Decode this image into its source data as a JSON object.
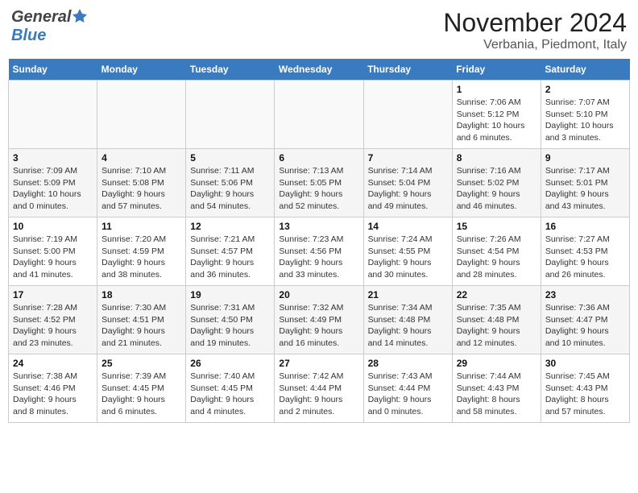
{
  "header": {
    "logo_general": "General",
    "logo_blue": "Blue",
    "month": "November 2024",
    "location": "Verbania, Piedmont, Italy"
  },
  "calendar": {
    "days_of_week": [
      "Sunday",
      "Monday",
      "Tuesday",
      "Wednesday",
      "Thursday",
      "Friday",
      "Saturday"
    ],
    "weeks": [
      [
        {
          "day": "",
          "info": ""
        },
        {
          "day": "",
          "info": ""
        },
        {
          "day": "",
          "info": ""
        },
        {
          "day": "",
          "info": ""
        },
        {
          "day": "",
          "info": ""
        },
        {
          "day": "1",
          "info": "Sunrise: 7:06 AM\nSunset: 5:12 PM\nDaylight: 10 hours\nand 6 minutes."
        },
        {
          "day": "2",
          "info": "Sunrise: 7:07 AM\nSunset: 5:10 PM\nDaylight: 10 hours\nand 3 minutes."
        }
      ],
      [
        {
          "day": "3",
          "info": "Sunrise: 7:09 AM\nSunset: 5:09 PM\nDaylight: 10 hours\nand 0 minutes."
        },
        {
          "day": "4",
          "info": "Sunrise: 7:10 AM\nSunset: 5:08 PM\nDaylight: 9 hours\nand 57 minutes."
        },
        {
          "day": "5",
          "info": "Sunrise: 7:11 AM\nSunset: 5:06 PM\nDaylight: 9 hours\nand 54 minutes."
        },
        {
          "day": "6",
          "info": "Sunrise: 7:13 AM\nSunset: 5:05 PM\nDaylight: 9 hours\nand 52 minutes."
        },
        {
          "day": "7",
          "info": "Sunrise: 7:14 AM\nSunset: 5:04 PM\nDaylight: 9 hours\nand 49 minutes."
        },
        {
          "day": "8",
          "info": "Sunrise: 7:16 AM\nSunset: 5:02 PM\nDaylight: 9 hours\nand 46 minutes."
        },
        {
          "day": "9",
          "info": "Sunrise: 7:17 AM\nSunset: 5:01 PM\nDaylight: 9 hours\nand 43 minutes."
        }
      ],
      [
        {
          "day": "10",
          "info": "Sunrise: 7:19 AM\nSunset: 5:00 PM\nDaylight: 9 hours\nand 41 minutes."
        },
        {
          "day": "11",
          "info": "Sunrise: 7:20 AM\nSunset: 4:59 PM\nDaylight: 9 hours\nand 38 minutes."
        },
        {
          "day": "12",
          "info": "Sunrise: 7:21 AM\nSunset: 4:57 PM\nDaylight: 9 hours\nand 36 minutes."
        },
        {
          "day": "13",
          "info": "Sunrise: 7:23 AM\nSunset: 4:56 PM\nDaylight: 9 hours\nand 33 minutes."
        },
        {
          "day": "14",
          "info": "Sunrise: 7:24 AM\nSunset: 4:55 PM\nDaylight: 9 hours\nand 30 minutes."
        },
        {
          "day": "15",
          "info": "Sunrise: 7:26 AM\nSunset: 4:54 PM\nDaylight: 9 hours\nand 28 minutes."
        },
        {
          "day": "16",
          "info": "Sunrise: 7:27 AM\nSunset: 4:53 PM\nDaylight: 9 hours\nand 26 minutes."
        }
      ],
      [
        {
          "day": "17",
          "info": "Sunrise: 7:28 AM\nSunset: 4:52 PM\nDaylight: 9 hours\nand 23 minutes."
        },
        {
          "day": "18",
          "info": "Sunrise: 7:30 AM\nSunset: 4:51 PM\nDaylight: 9 hours\nand 21 minutes."
        },
        {
          "day": "19",
          "info": "Sunrise: 7:31 AM\nSunset: 4:50 PM\nDaylight: 9 hours\nand 19 minutes."
        },
        {
          "day": "20",
          "info": "Sunrise: 7:32 AM\nSunset: 4:49 PM\nDaylight: 9 hours\nand 16 minutes."
        },
        {
          "day": "21",
          "info": "Sunrise: 7:34 AM\nSunset: 4:48 PM\nDaylight: 9 hours\nand 14 minutes."
        },
        {
          "day": "22",
          "info": "Sunrise: 7:35 AM\nSunset: 4:48 PM\nDaylight: 9 hours\nand 12 minutes."
        },
        {
          "day": "23",
          "info": "Sunrise: 7:36 AM\nSunset: 4:47 PM\nDaylight: 9 hours\nand 10 minutes."
        }
      ],
      [
        {
          "day": "24",
          "info": "Sunrise: 7:38 AM\nSunset: 4:46 PM\nDaylight: 9 hours\nand 8 minutes."
        },
        {
          "day": "25",
          "info": "Sunrise: 7:39 AM\nSunset: 4:45 PM\nDaylight: 9 hours\nand 6 minutes."
        },
        {
          "day": "26",
          "info": "Sunrise: 7:40 AM\nSunset: 4:45 PM\nDaylight: 9 hours\nand 4 minutes."
        },
        {
          "day": "27",
          "info": "Sunrise: 7:42 AM\nSunset: 4:44 PM\nDaylight: 9 hours\nand 2 minutes."
        },
        {
          "day": "28",
          "info": "Sunrise: 7:43 AM\nSunset: 4:44 PM\nDaylight: 9 hours\nand 0 minutes."
        },
        {
          "day": "29",
          "info": "Sunrise: 7:44 AM\nSunset: 4:43 PM\nDaylight: 8 hours\nand 58 minutes."
        },
        {
          "day": "30",
          "info": "Sunrise: 7:45 AM\nSunset: 4:43 PM\nDaylight: 8 hours\nand 57 minutes."
        }
      ]
    ]
  }
}
